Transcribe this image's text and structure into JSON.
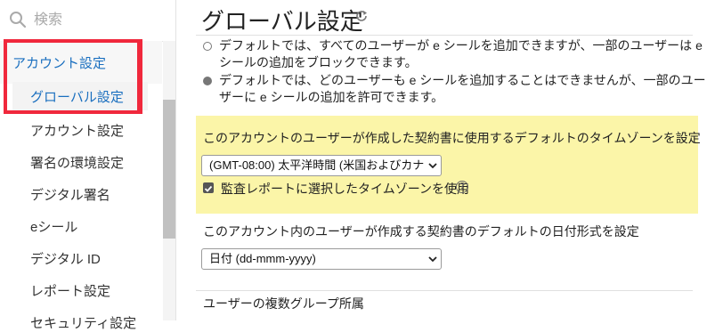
{
  "sidebar": {
    "search_placeholder": "検索",
    "section_label": "アカウント設定",
    "active_item": "グローバル設定",
    "items": [
      "アカウント設定",
      "署名の環境設定",
      "デジタル署名",
      "eシール",
      "デジタル ID",
      "レポート設定",
      "セキュリティ設定"
    ]
  },
  "main": {
    "title": "グローバル設定",
    "option1": "デフォルトでは、すべてのユーザーが e シールを追加できますが、一部のユーザーは e シールの追加をブロックできます。",
    "option2": "デフォルトでは、どのユーザーも e シールを追加することはできませんが、一部のユーザーに e シールの追加を許可できます。",
    "timezone_label": "このアカウントのユーザーが作成した契約書に使用するデフォルトのタイムゾーンを設定",
    "timezone_value": "(GMT-08:00) 太平洋時間 (米国およびカナ",
    "audit_checkbox_label": "監査レポートに選択したタイムゾーンを使用",
    "date_label": "このアカウント内のユーザーが作成する契約書のデフォルトの日付形式を設定",
    "date_value": "日付 (dd-mmm-yyyy)",
    "multi_group_label": "ユーザーの複数グループ所属"
  },
  "icons": [
    "search-icon",
    "refresh-icon",
    "chevron-down-icon",
    "help-icon"
  ],
  "colors": {
    "link": "#1a6fbf",
    "highlight": "#fbf5a8",
    "annotation": "#f0283c"
  }
}
